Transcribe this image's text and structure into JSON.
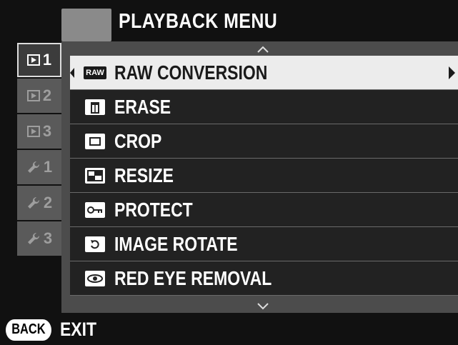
{
  "header": {
    "title": "PLAYBACK MENU"
  },
  "tabs": [
    {
      "label": "1",
      "icon": "playback-icon",
      "active": true
    },
    {
      "label": "2",
      "icon": "playback-icon",
      "active": false
    },
    {
      "label": "3",
      "icon": "playback-icon",
      "active": false
    },
    {
      "label": "1",
      "icon": "wrench-icon",
      "active": false
    },
    {
      "label": "2",
      "icon": "wrench-icon",
      "active": false
    },
    {
      "label": "3",
      "icon": "wrench-icon",
      "active": false
    }
  ],
  "menu": {
    "items": [
      {
        "label": "RAW CONVERSION",
        "icon": "raw-icon",
        "icon_text": "RAW",
        "selected": true
      },
      {
        "label": "ERASE",
        "icon": "trash-icon",
        "selected": false
      },
      {
        "label": "CROP",
        "icon": "crop-icon",
        "selected": false
      },
      {
        "label": "RESIZE",
        "icon": "resize-icon",
        "selected": false
      },
      {
        "label": "PROTECT",
        "icon": "key-icon",
        "selected": false
      },
      {
        "label": "IMAGE ROTATE",
        "icon": "rotate-icon",
        "selected": false
      },
      {
        "label": "RED EYE REMOVAL",
        "icon": "eye-icon",
        "selected": false
      }
    ]
  },
  "footer": {
    "back_label": "BACK",
    "exit_label": "EXIT"
  },
  "colors": {
    "selected_row": "#ececec",
    "panel": "#4c4c4c",
    "row": "#222222",
    "header_tab": "#8a8a8a"
  }
}
